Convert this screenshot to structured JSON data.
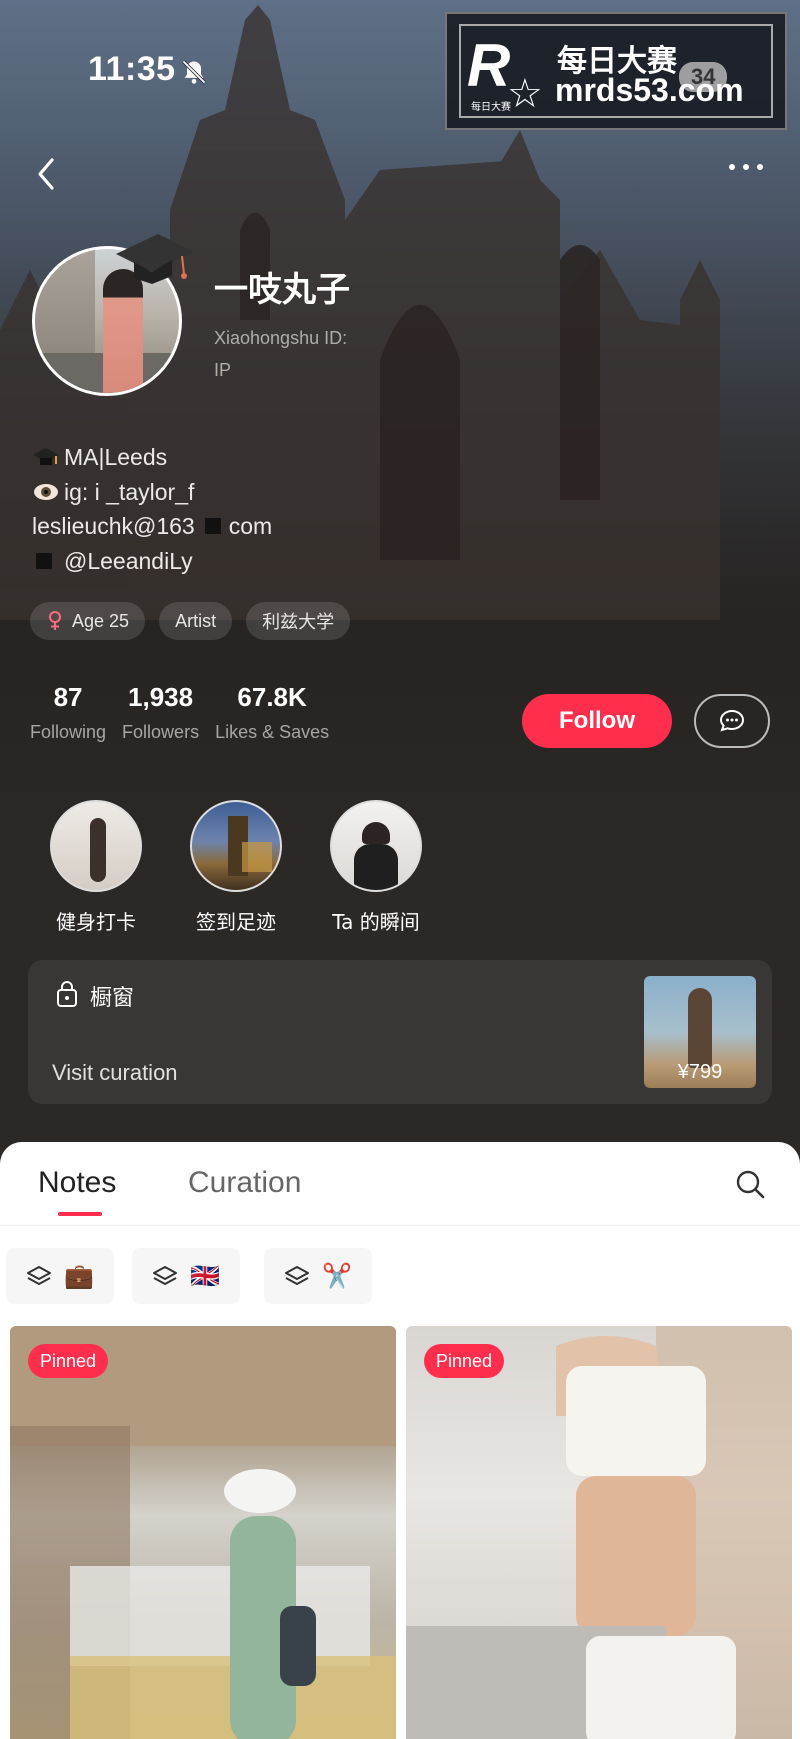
{
  "status_bar": {
    "time": "11:35"
  },
  "watermark": {
    "logo": "R",
    "logo_sub": "每日大赛",
    "title": "每日大赛",
    "url": "mrds53.com",
    "badge": "34"
  },
  "profile": {
    "username": "一吱丸子",
    "xhs_id_label": "Xiaohongshu ID:",
    "ip_label": "IP",
    "bio": [
      {
        "icon": "graduation-cap-icon",
        "text": "MA|Leeds"
      },
      {
        "icon": "eye-emoji-icon",
        "text": "ig: i _taylor_f"
      },
      {
        "icon": "",
        "text_before": "leslieuchk@163",
        "text": "com"
      },
      {
        "icon": "square-icon",
        "text": "@LeeandiLy"
      }
    ],
    "tags": [
      {
        "icon": "female-icon",
        "label": "Age 25"
      },
      {
        "label": "Artist"
      },
      {
        "label": "利兹大学"
      }
    ],
    "stats": [
      {
        "value": "87",
        "label": "Following"
      },
      {
        "value": "1,938",
        "label": "Followers"
      },
      {
        "value": "67.8K",
        "label": "Likes & Saves"
      }
    ],
    "follow_label": "Follow",
    "accent_color": "#ff2e4d"
  },
  "highlights": [
    {
      "label": "健身打卡"
    },
    {
      "label": "签到足迹"
    },
    {
      "label": "Ta 的瞬间"
    }
  ],
  "shop": {
    "title": "橱窗",
    "link": "Visit curation",
    "price": "¥799"
  },
  "tabs": {
    "notes": "Notes",
    "curation": "Curation"
  },
  "collections": [
    {
      "icon": "stack-icon",
      "emoji": "💼"
    },
    {
      "icon": "stack-icon",
      "emoji": "🇬🇧"
    },
    {
      "icon": "stack-icon",
      "emoji": "✂️"
    }
  ],
  "notes": [
    {
      "badge": "Pinned"
    },
    {
      "badge": "Pinned"
    }
  ]
}
